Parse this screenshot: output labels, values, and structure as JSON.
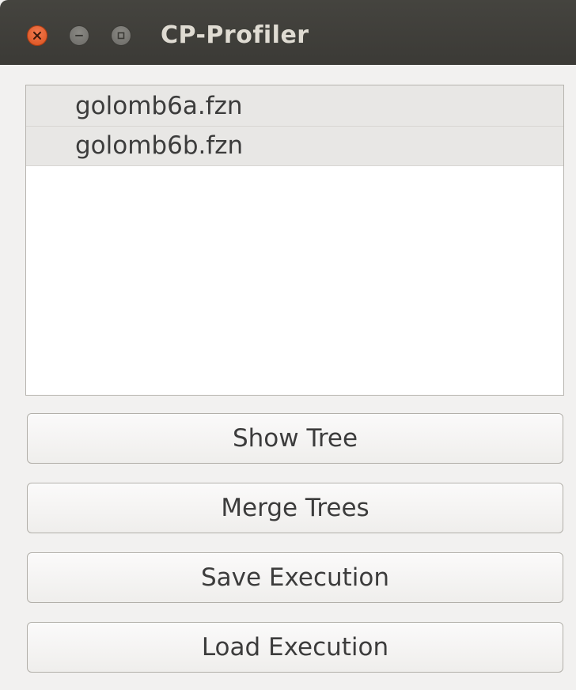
{
  "window": {
    "title": "CP-Profiler",
    "controls": {
      "close_icon": "close-icon",
      "minimize_icon": "minimize-icon",
      "maximize_icon": "maximize-icon"
    }
  },
  "executions": {
    "items": [
      {
        "label": "golomb6a.fzn"
      },
      {
        "label": "golomb6b.fzn"
      }
    ]
  },
  "actions": {
    "show_tree": "Show Tree",
    "merge_trees": "Merge Trees",
    "save_execution": "Save Execution",
    "load_execution": "Load Execution"
  },
  "colors": {
    "titlebar": "#3f3e3a",
    "close_button": "#e5602b",
    "window_background": "#f2f1f0",
    "list_item_background": "#e8e7e5"
  }
}
